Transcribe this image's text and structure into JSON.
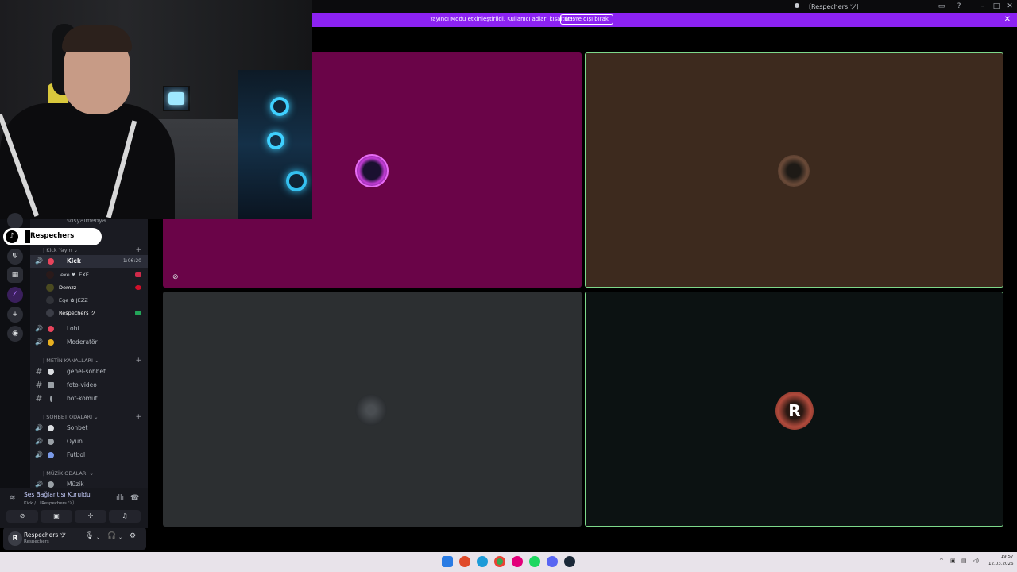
{
  "window": {
    "title": "〔Respechers ツ〕"
  },
  "banner": {
    "message": "Yayıncı Modu etkinleştirildi. Kullanıcı adları kısaltıldı.",
    "button_label": "Devre dışı bırak"
  },
  "tiktok_overlay": {
    "name": "Respechers"
  },
  "sidebar": {
    "partial_channel_label": "sosyalmedya",
    "kick_category": "| Kick Yayın ⌄",
    "kick_channel": {
      "label": "Kick",
      "timer": "1:06:20"
    },
    "voice_users": [
      {
        "name": ".exe  ❤ .EXE"
      },
      {
        "name": "Demzz"
      },
      {
        "name": "Ege  ✿ JEZZ"
      },
      {
        "name": "Respechers ツ"
      }
    ],
    "voice_channels_a": [
      {
        "label": "Lobi"
      },
      {
        "label": "Moderatör"
      }
    ],
    "text_category": "| METİN KANALLARI ⌄",
    "text_channels": [
      {
        "label": "genel-sohbet"
      },
      {
        "label": "foto-video"
      },
      {
        "label": "bot-komut"
      }
    ],
    "chat_category": "| SOHBET ODALARI ⌄",
    "chat_channels": [
      {
        "label": "Sohbet"
      },
      {
        "label": "Oyun"
      },
      {
        "label": "Futbol"
      }
    ],
    "music_category": "| MÜZİK ODALARI ⌄",
    "music_channels": [
      {
        "label": "Müzik"
      }
    ]
  },
  "voice_panel": {
    "title": "Ses Bağlantısı Kuruldu",
    "subtitle": "Kick / 〔Respechers ツ〕"
  },
  "user_panel": {
    "name": "Respechers ツ",
    "status": "Respechers"
  },
  "taskbar": {
    "time": "19:57",
    "date": "12.03.2026"
  },
  "colors": {
    "banner": "#8c22f2",
    "pink_tile": "#6a0448",
    "brown_tile": "#3d2a1e",
    "grey_tile": "#2c2f31",
    "dark_tile": "#0c1212",
    "speaking_border": "#7dd88a"
  }
}
